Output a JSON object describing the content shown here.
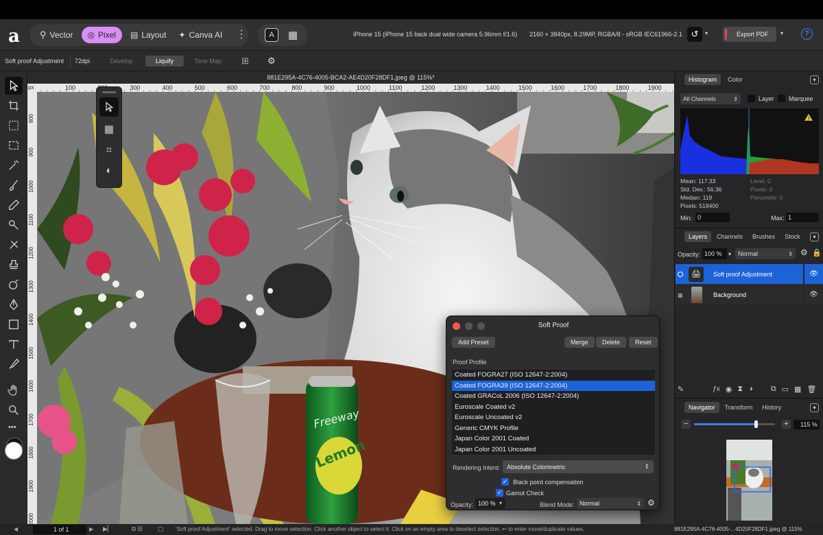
{
  "toolbar": {
    "personas": [
      {
        "label": "Vector"
      },
      {
        "label": "Pixel"
      },
      {
        "label": "Layout"
      },
      {
        "label": "Canva AI"
      }
    ],
    "doc_info": "iPhone 15 (iPhone 15 back dual wide camera 5.96mm f/1.6)",
    "doc_specs": "2160 × 3840px, 8.29MP, RGBA/8 - sRGB IEC61966-2.1",
    "export_label": "Export PDF",
    "help": "?"
  },
  "context": {
    "name": "Soft proof Adjustment",
    "dpi": "72dpi",
    "tabs": [
      "Develop",
      "Liquify",
      "Tone Map"
    ]
  },
  "document": {
    "title": "881E295A-4C76-4005-BCA2-AE4D20F28DF1.jpeg @ 115%*",
    "ruler_unit": "px",
    "hticks": [
      "100",
      "200",
      "300",
      "400",
      "500",
      "600",
      "700",
      "800",
      "900",
      "1000",
      "1100",
      "1200",
      "1300",
      "1400",
      "1500",
      "1600",
      "1700",
      "1800",
      "1900"
    ],
    "vticks": [
      "800",
      "900",
      "1000",
      "1100",
      "1200",
      "1300",
      "1400",
      "1500",
      "1600",
      "1700",
      "1800",
      "1900",
      "2000"
    ]
  },
  "histogram": {
    "tabs": [
      "Histogram",
      "Color"
    ],
    "channel": "All Channels",
    "layer_label": "Layer",
    "marquee_label": "Marquee",
    "stats_left": [
      "Mean: 117.33",
      "Std. Dev.: 56.36",
      "Median: 119",
      "Pixels: 518400"
    ],
    "stats_right": [
      "Level: 0",
      "Pixels: 0",
      "Percentile: 0"
    ],
    "min_label": "Min:",
    "min_value": "0",
    "max_label": "Max:",
    "max_value": "1"
  },
  "layers": {
    "tabs": [
      "Layers",
      "Channels",
      "Brushes",
      "Stock"
    ],
    "opacity_label": "Opacity:",
    "opacity": "100 %",
    "blend": "Normal",
    "items": [
      {
        "name": "Soft proof Adjustment"
      },
      {
        "name": "Background"
      }
    ]
  },
  "navigator": {
    "tabs": [
      "Navigator",
      "Transform",
      "History"
    ],
    "zoom": "115 %"
  },
  "softproof": {
    "title": "Soft Proof",
    "add_preset": "Add Preset",
    "merge": "Merge",
    "delete": "Delete",
    "reset": "Reset",
    "profile_label": "Proof Profile",
    "profiles": [
      "Coated FOGRA27 (ISO 12647-2:2004)",
      "Coated FOGRA39 (ISO 12647-2:2004)",
      "Coated GRACoL 2006 (ISO 12647-2:2004)",
      "Euroscale Coated v2",
      "Euroscale Uncoated v2",
      "Generic CMYK Profile",
      "Japan Color 2001 Coated",
      "Japan Color 2001 Uncoated"
    ],
    "selected": 1,
    "intent_label": "Rendering Intent:",
    "intent": "Absolute Colorimetric",
    "bpc": "Black point compensation",
    "gamut": "Gamut Check",
    "opacity_label": "Opacity:",
    "opacity": "100 %",
    "blend_label": "Blend Mode:",
    "blend": "Normal"
  },
  "status": {
    "page": "1 of 1",
    "message": "'Soft proof Adjustment' selected. Drag to move selection. Click another object to select it. Click on an empty area to deselect selection. ↩ to enter move/duplicate values.",
    "file": "881E295A-4C76-4005-...4D20F28DF1.jpeg @ 115%"
  },
  "canned": {
    "text": "Freeway",
    "text2": "Lemon"
  },
  "colors": {
    "accent": "#1d63d8",
    "pixel_persona": "#d98ef5",
    "export": "#e04848"
  }
}
